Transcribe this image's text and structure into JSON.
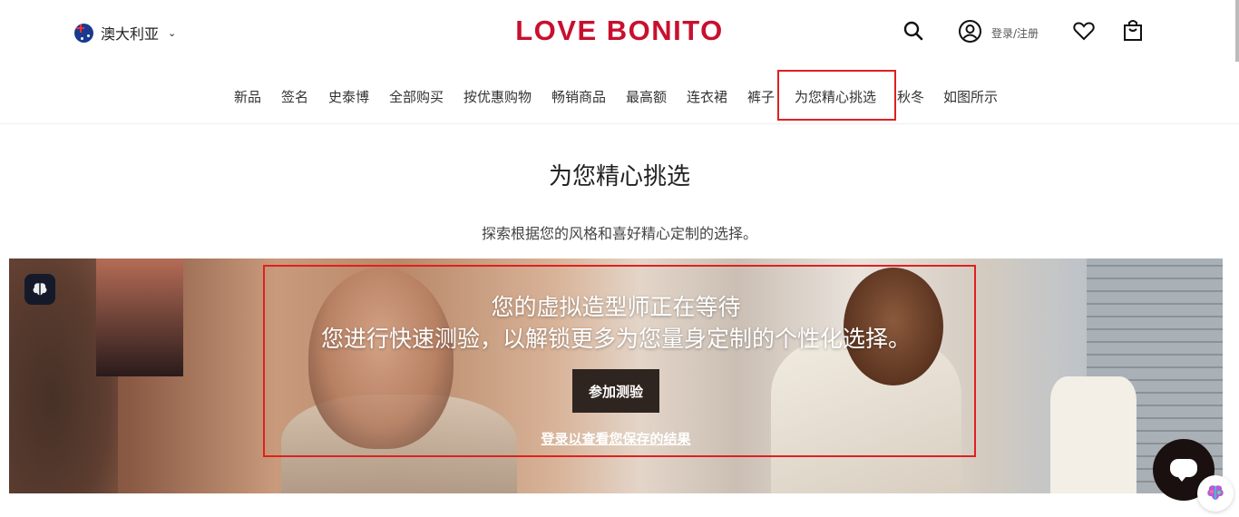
{
  "header": {
    "locale_label": "澳大利亚",
    "logo": "LOVE BONITO",
    "login_label": "登录/注册"
  },
  "nav": {
    "items": [
      "新品",
      "签名",
      "史泰博",
      "全部购买",
      "按优惠购物",
      "畅销商品",
      "最高额",
      "连衣裙",
      "裤子",
      "为您精心挑选",
      "秋冬",
      "如图所示"
    ],
    "active": "为您精心挑选"
  },
  "page": {
    "title": "为您精心挑选",
    "subtitle": "探索根据您的风格和喜好精心定制的选择。"
  },
  "banner": {
    "line1": "您的虚拟造型师正在等待",
    "line2": "您进行快速测验，以解锁更多为您量身定制的个性化选择。",
    "quiz_button": "参加测验",
    "login_link": "登录以查看您保存的结果"
  },
  "icons": [
    "flag-au-icon",
    "chevron-down-icon",
    "search-icon",
    "account-icon",
    "heart-icon",
    "bag-icon",
    "brain-icon",
    "chat-icon",
    "ai-assistant-icon"
  ],
  "colors": {
    "brand": "#c8102e",
    "highlight": "#e02020",
    "button_bg": "#2f2520"
  }
}
